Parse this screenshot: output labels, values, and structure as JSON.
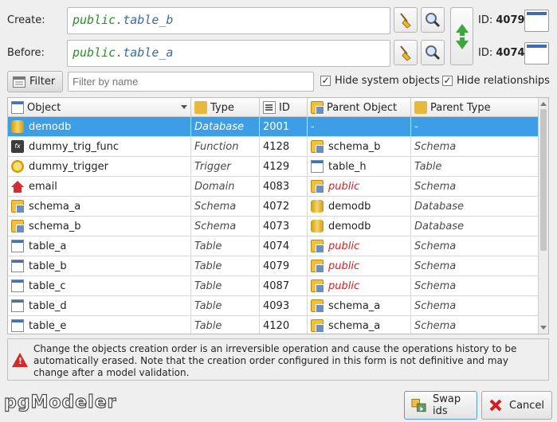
{
  "form": {
    "create_label": "Create:",
    "before_label": "Before:",
    "create_object": {
      "schema": "public",
      "table": "table_b"
    },
    "before_object": {
      "schema": "public",
      "table": "table_a"
    },
    "create_id_label": "ID:",
    "create_id": "4079",
    "before_id_label": "ID:",
    "before_id": "4074"
  },
  "filter": {
    "button_label": "Filter",
    "placeholder": "Filter by name",
    "hide_system_label": "Hide system objects",
    "hide_system_checked": true,
    "hide_relationships_label": "Hide relationships",
    "hide_relationships_checked": true
  },
  "table": {
    "columns": [
      "Object",
      "Type",
      "ID",
      "Parent Object",
      "Parent Type"
    ],
    "rows": [
      {
        "icon": "database-icon",
        "object": "demodb",
        "type": "Database",
        "id": "2001",
        "parent_icon": "",
        "parent": "-",
        "parent_type": "-",
        "parent_red": false,
        "selected": true
      },
      {
        "icon": "function-icon",
        "object": "dummy_trig_func",
        "type": "Function",
        "id": "4128",
        "parent_icon": "schema-icon",
        "parent": "schema_b",
        "parent_type": "Schema",
        "parent_red": false,
        "selected": false
      },
      {
        "icon": "trigger-icon",
        "object": "dummy_trigger",
        "type": "Trigger",
        "id": "4129",
        "parent_icon": "table-icon",
        "parent": "table_h",
        "parent_type": "Table",
        "parent_red": false,
        "selected": false
      },
      {
        "icon": "domain-icon",
        "object": "email",
        "type": "Domain",
        "id": "4083",
        "parent_icon": "schema-icon",
        "parent": "public",
        "parent_type": "Schema",
        "parent_red": true,
        "selected": false
      },
      {
        "icon": "schema-icon",
        "object": "schema_a",
        "type": "Schema",
        "id": "4072",
        "parent_icon": "database-icon",
        "parent": "demodb",
        "parent_type": "Database",
        "parent_red": false,
        "selected": false
      },
      {
        "icon": "schema-icon",
        "object": "schema_b",
        "type": "Schema",
        "id": "4073",
        "parent_icon": "database-icon",
        "parent": "demodb",
        "parent_type": "Database",
        "parent_red": false,
        "selected": false
      },
      {
        "icon": "table-icon",
        "object": "table_a",
        "type": "Table",
        "id": "4074",
        "parent_icon": "schema-icon",
        "parent": "public",
        "parent_type": "Schema",
        "parent_red": true,
        "selected": false
      },
      {
        "icon": "table-icon",
        "object": "table_b",
        "type": "Table",
        "id": "4079",
        "parent_icon": "schema-icon",
        "parent": "public",
        "parent_type": "Schema",
        "parent_red": true,
        "selected": false
      },
      {
        "icon": "table-icon",
        "object": "table_c",
        "type": "Table",
        "id": "4087",
        "parent_icon": "schema-icon",
        "parent": "public",
        "parent_type": "Schema",
        "parent_red": true,
        "selected": false
      },
      {
        "icon": "table-icon",
        "object": "table_d",
        "type": "Table",
        "id": "4093",
        "parent_icon": "schema-icon",
        "parent": "schema_a",
        "parent_type": "Schema",
        "parent_red": false,
        "selected": false
      },
      {
        "icon": "table-icon",
        "object": "table_e",
        "type": "Table",
        "id": "4120",
        "parent_icon": "schema-icon",
        "parent": "schema_a",
        "parent_type": "Schema",
        "parent_red": false,
        "selected": false
      }
    ]
  },
  "notice": {
    "text": "Change the objects creation order is an irreversible operation and cause the operations history to be automatically erased. Note that the creation order configured in this form is not definitive and may change after a model validation."
  },
  "footer": {
    "logo_text": "pgModeler",
    "swap_label": "Swap ids",
    "cancel_label": "Cancel"
  },
  "colors": {
    "selection": "#3d9ee6",
    "parent_red": "#d42020",
    "schema_green": "#2e8b2e",
    "table_blue": "#3b6aa0"
  }
}
